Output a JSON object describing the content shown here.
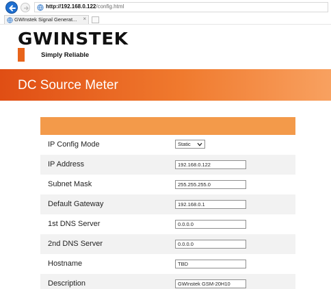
{
  "browser": {
    "url_host": "http://192.168.0.122",
    "url_path": "/config.html",
    "tab_title": "GWInstek Signal Generat...",
    "tab_close": "×"
  },
  "brand": {
    "logo": "GWINSTEK",
    "slogan": "Simply Reliable"
  },
  "page": {
    "title": "DC Source Meter"
  },
  "config": {
    "rows": [
      {
        "label": "IP Config Mode",
        "value": "Static"
      },
      {
        "label": "IP Address",
        "value": "192.168.0.122"
      },
      {
        "label": "Subnet Mask",
        "value": "255.255.255.0"
      },
      {
        "label": "Default Gateway",
        "value": "192.168.0.1"
      },
      {
        "label": "1st DNS Server",
        "value": "0.0.0.0"
      },
      {
        "label": "2nd DNS Server",
        "value": "0.0.0.0"
      },
      {
        "label": "Hostname",
        "value": "TBD"
      },
      {
        "label": "Description",
        "value": "GWInstek GSM-20H10"
      }
    ]
  },
  "colors": {
    "accent": "#f07a2e",
    "header_row": "#f39a4a",
    "back_button": "#1f6fd0"
  },
  "icons": {
    "back": "arrow-left-icon",
    "forward": "arrow-right-icon",
    "site": "globe-icon",
    "dropdown": "chevron-down-icon"
  }
}
